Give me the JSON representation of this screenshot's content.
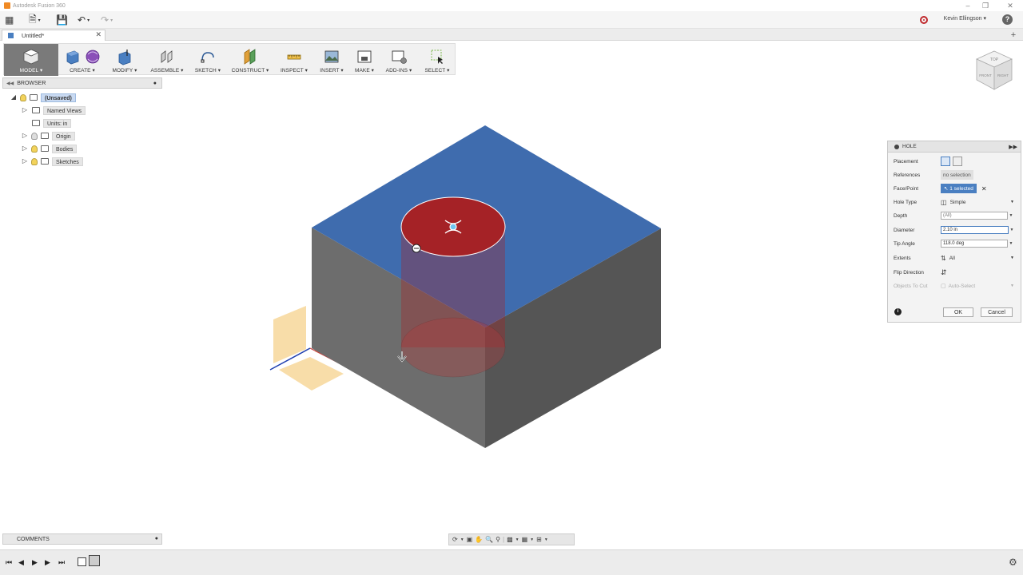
{
  "window": {
    "title": "Autodesk Fusion 360"
  },
  "user": {
    "name": "Kevin Ellingson ▾",
    "help": "?"
  },
  "document_tab": {
    "title": "Untitled*"
  },
  "toolbar": {
    "model": "MODEL ▾",
    "create": "CREATE ▾",
    "modify": "MODIFY ▾",
    "assemble": "ASSEMBLE ▾",
    "sketch": "SKETCH ▾",
    "construct": "CONSTRUCT ▾",
    "inspect": "INSPECT ▾",
    "insert": "INSERT ▾",
    "make": "MAKE ▾",
    "addins": "ADD-INS ▾",
    "select": "SELECT ▾"
  },
  "browser": {
    "title": "BROWSER",
    "items": [
      {
        "label": "(Unsaved)"
      },
      {
        "label": "Named Views"
      },
      {
        "label": "Units: in"
      },
      {
        "label": "Origin"
      },
      {
        "label": "Bodies"
      },
      {
        "label": "Sketches"
      }
    ]
  },
  "viewcube": {
    "top": "TOP",
    "front": "FRONT",
    "right": "RIGHT"
  },
  "hole_dialog": {
    "title": "HOLE",
    "placement": "Placement",
    "references": "References",
    "references_value": "no selection",
    "face_point": "Face/Point",
    "face_point_value": "1 selected",
    "hole_type": "Hole Type",
    "hole_type_value": "Simple",
    "depth": "Depth",
    "depth_value": "(All)",
    "diameter": "Diameter",
    "diameter_value": "2.10 in",
    "tip_angle": "Tip Angle",
    "tip_angle_value": "118.0 deg",
    "extents": "Extents",
    "extents_value": "All",
    "flip_direction": "Flip Direction",
    "objects_to_cut": "Objects To Cut",
    "objects_to_cut_value": "Auto-Select",
    "ok": "OK",
    "cancel": "Cancel"
  },
  "comments": {
    "title": "COMMENTS"
  },
  "colors": {
    "top_face": "#3f6cae",
    "side_face": "#6f6f6f",
    "hole_red": "#a52226",
    "accent": "#4a7fc1"
  }
}
